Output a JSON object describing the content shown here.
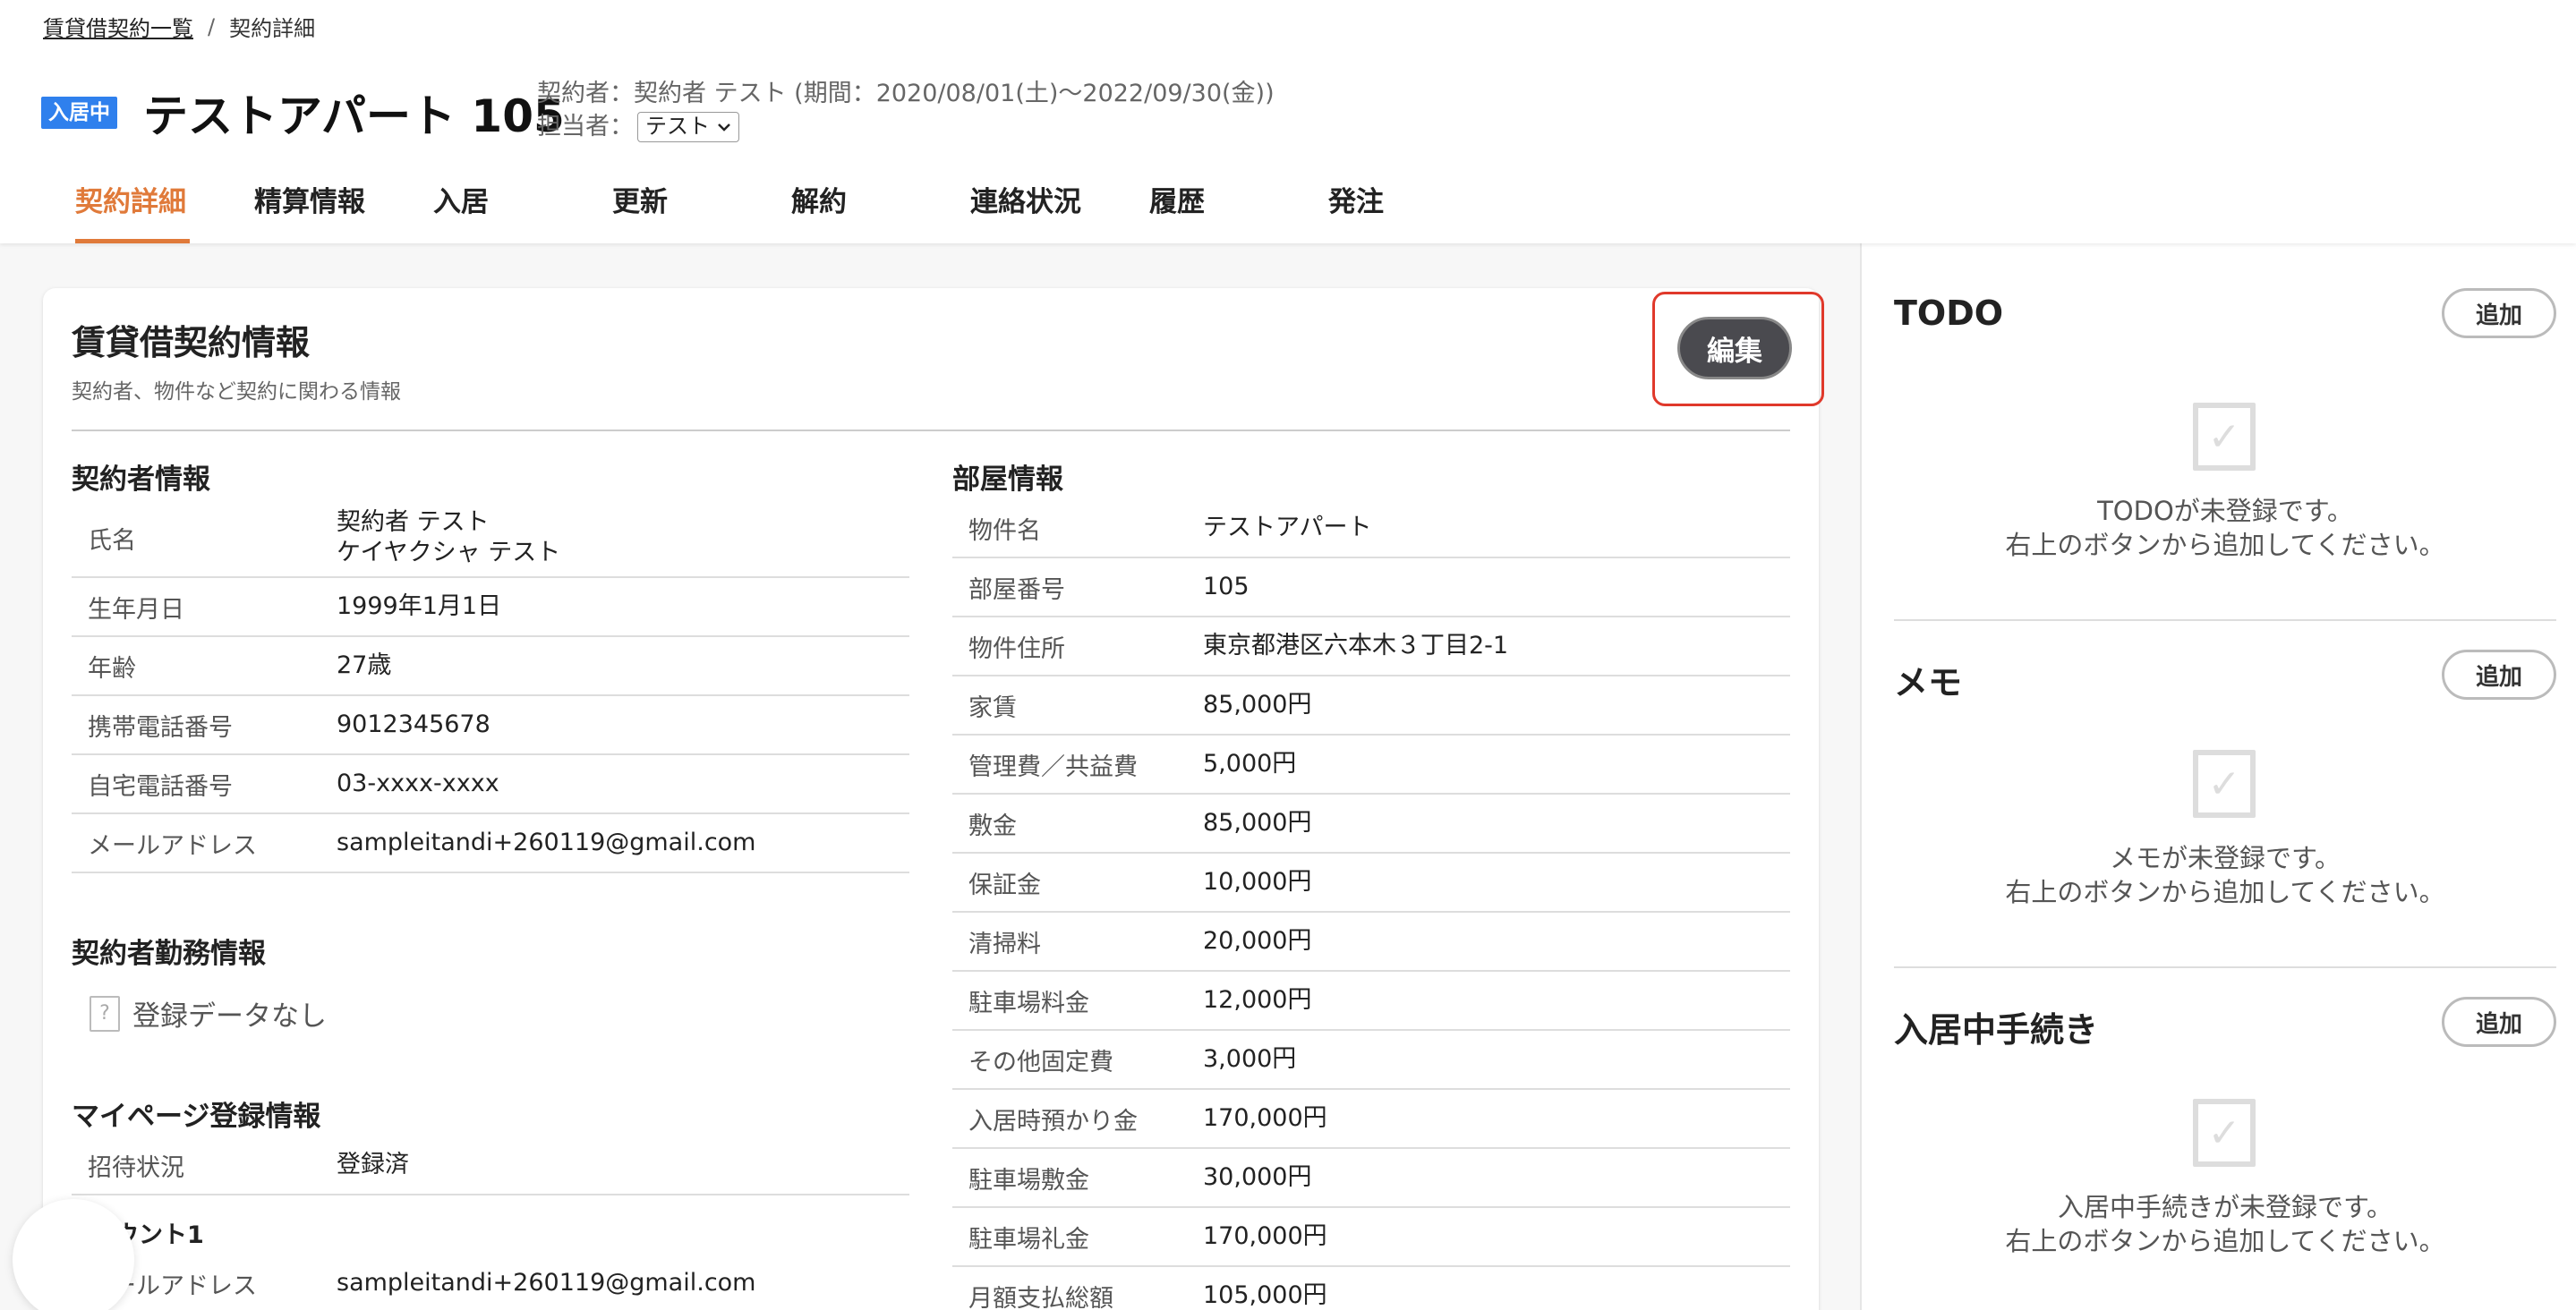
{
  "breadcrumb": {
    "parent": "賃貸借契約一覧",
    "separator": "/",
    "current": "契約詳細"
  },
  "header": {
    "status_badge": "入居中",
    "title": "テストアパート 105",
    "contract_line": "契約者：契約者 テスト (期間：2020/08/01(土)〜2022/09/30(金))",
    "assignee_label": "担当者：",
    "assignee_value": "テスト"
  },
  "tabs": [
    {
      "label": "契約詳細",
      "active": true
    },
    {
      "label": "精算情報"
    },
    {
      "label": "入居"
    },
    {
      "label": "更新"
    },
    {
      "label": "解約"
    },
    {
      "label": "連絡状況"
    },
    {
      "label": "履歴"
    },
    {
      "label": "発注"
    }
  ],
  "card": {
    "title": "賃貸借契約情報",
    "subtitle": "契約者、物件など契約に関わる情報",
    "edit_label": "編集"
  },
  "contractor": {
    "title": "契約者情報",
    "rows": [
      {
        "label": "氏名",
        "value": "契約者 テスト",
        "value2": "ケイヤクシャ テスト"
      },
      {
        "label": "生年月日",
        "value": "1999年1月1日"
      },
      {
        "label": "年齢",
        "value": "27歳"
      },
      {
        "label": "携帯電話番号",
        "value": "9012345678"
      },
      {
        "label": "自宅電話番号",
        "value": "03-xxxx-xxxx"
      },
      {
        "label": "メールアドレス",
        "value": "sampleitandi+260119@gmail.com"
      }
    ]
  },
  "employment": {
    "title": "契約者勤務情報",
    "empty": "登録データなし"
  },
  "mypage": {
    "title": "マイページ登録情報",
    "rows": [
      {
        "label": "招待状況",
        "value": "登録済"
      }
    ],
    "account_label": "ウント1",
    "email_row": {
      "label": "メールアドレス",
      "value": "sampleitandi+260119@gmail.com"
    }
  },
  "room": {
    "title": "部屋情報",
    "rows": [
      {
        "label": "物件名",
        "value": "テストアパート"
      },
      {
        "label": "部屋番号",
        "value": "105"
      },
      {
        "label": "物件住所",
        "value": "東京都港区六本木３丁目2-1"
      },
      {
        "label": "家賃",
        "value": "85,000円"
      },
      {
        "label": "管理費／共益費",
        "value": "5,000円"
      },
      {
        "label": "敷金",
        "value": "85,000円"
      },
      {
        "label": "保証金",
        "value": "10,000円"
      },
      {
        "label": "清掃料",
        "value": "20,000円"
      },
      {
        "label": "駐車場料金",
        "value": "12,000円"
      },
      {
        "label": "その他固定費",
        "value": "3,000円"
      },
      {
        "label": "入居時預かり金",
        "value": "170,000円"
      },
      {
        "label": "駐車場敷金",
        "value": "30,000円"
      },
      {
        "label": "駐車場礼金",
        "value": "170,000円"
      },
      {
        "label": "月額支払総額",
        "value": "105,000円"
      }
    ]
  },
  "sidebar": {
    "todo": {
      "title": "TODO",
      "add": "追加",
      "msg1": "TODOが未登録です。",
      "msg2": "右上のボタンから追加してください。"
    },
    "memo": {
      "title": "メモ",
      "add": "追加",
      "msg1": "メモが未登録です。",
      "msg2": "右上のボタンから追加してください。"
    },
    "procedure": {
      "title": "入居中手続き",
      "add": "追加",
      "msg1": "入居中手続きが未登録です。",
      "msg2": "右上のボタンから追加してください。"
    }
  },
  "colors": {
    "accent": "#e07a3a",
    "badge": "#2f80ed",
    "edit_outline": "#e0392b",
    "edit_button": "#4a4a4f"
  }
}
